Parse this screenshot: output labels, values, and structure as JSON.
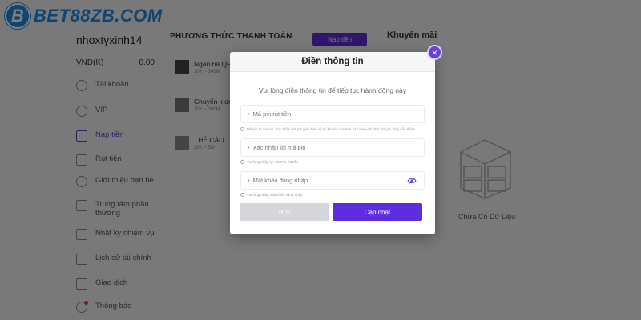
{
  "brand": {
    "logo_letter": "B",
    "logo_text": "BET88ZB.COM"
  },
  "user": {
    "username": "nhoxtyxinh14",
    "currency": "VND(K)",
    "balance": "0.00"
  },
  "sidebar": {
    "items": [
      {
        "label": "Tài khoản",
        "icon": "user-icon"
      },
      {
        "label": "VIP",
        "icon": "vip-icon"
      },
      {
        "label": "Nạp tiền",
        "icon": "deposit-icon",
        "active": true
      },
      {
        "label": "Rút tiền",
        "icon": "withdraw-icon"
      },
      {
        "label": "Giới thiệu bạn bè",
        "icon": "referral-icon"
      },
      {
        "label": "Trung tâm phần thưởng",
        "icon": "reward-icon"
      },
      {
        "label": "Nhật ký nhiệm vụ",
        "icon": "task-log-icon"
      },
      {
        "label": "Lịch sử tài chính",
        "icon": "history-icon"
      },
      {
        "label": "Giao dịch",
        "icon": "transaction-icon"
      },
      {
        "label": "Thông báo",
        "icon": "bell-icon"
      }
    ]
  },
  "payment": {
    "title": "PHƯƠNG THỨC THANH TOÁN",
    "deposit_button": "Nạp tiền",
    "methods": [
      {
        "label": "Ngân hà QR",
        "sub": "10K ~ 300M"
      },
      {
        "label": "Chuyển k online",
        "sub": "10K ~ 300M"
      },
      {
        "label": "THẺ CÀO",
        "sub": "10K ~ 5M"
      }
    ]
  },
  "promo": {
    "title": "Khuyến mãi",
    "empty_text": "Chưa Có Dữ Liệu"
  },
  "modal": {
    "title": "Điền thông tin",
    "close_symbol": "×",
    "description": "Vui lòng điền thông tin để tiếp tục hành động này",
    "fields": [
      {
        "placeholder": "Mã pin rút tiền",
        "hint": "Mã pin từ 6-8 số. Xác nhận mã pin giúp bảo vệ tài khoản của bạn. Vui lòng ghi nhớ mã pin, hãy cẩn thận!"
      },
      {
        "placeholder": "Xác nhận lại mã pin",
        "hint": "Vui lòng nhập lại mã PIN rút tiền"
      },
      {
        "placeholder": "Mật khẩu đăng nhập",
        "hint": "Vui lòng nhập mật khẩu đăng nhập"
      }
    ],
    "cancel_label": "Hủy",
    "submit_label": "Cập nhật"
  },
  "colors": {
    "accent": "#5d2ee0",
    "brand": "#1f8ae0",
    "overlay": "rgba(0,0,0,0.5)"
  }
}
